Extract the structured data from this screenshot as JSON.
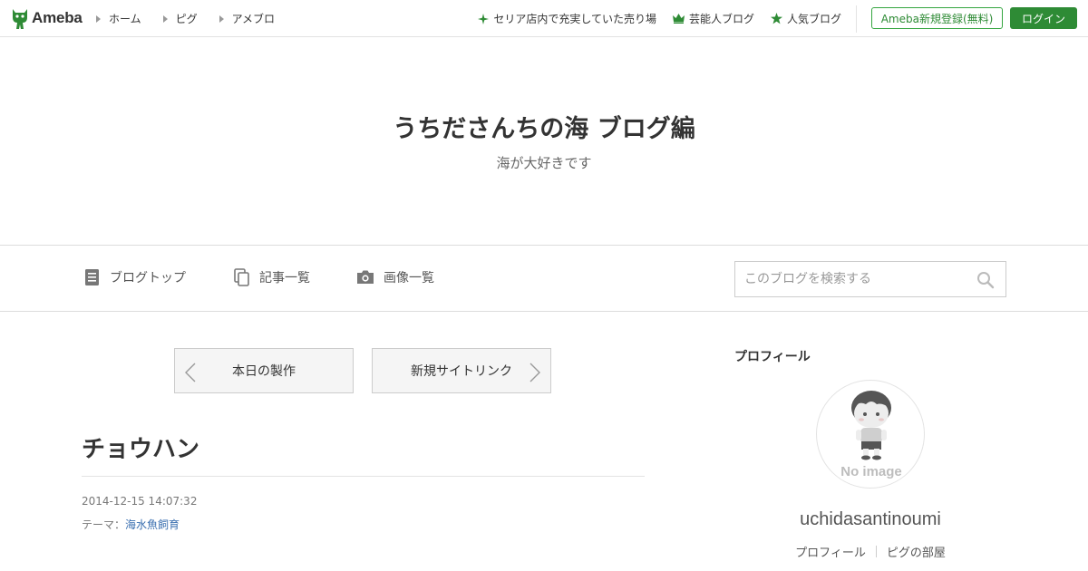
{
  "header": {
    "logo_text": "Ameba",
    "nav": [
      {
        "label": "ホーム"
      },
      {
        "label": "ピグ"
      },
      {
        "label": "アメブロ"
      }
    ],
    "links": [
      {
        "label": "セリア店内で充実していた売り場",
        "icon": "sparkle-icon"
      },
      {
        "label": "芸能人ブログ",
        "icon": "crown-icon"
      },
      {
        "label": "人気ブログ",
        "icon": "star-icon"
      }
    ],
    "register_label": "Ameba新規登録(無料)",
    "login_label": "ログイン",
    "accent_color": "#2e8b35"
  },
  "blog": {
    "title": "うちださんちの海 ブログ編",
    "description": "海が大好きです"
  },
  "blog_nav": {
    "items": [
      {
        "label": "ブログトップ",
        "icon": "document-icon"
      },
      {
        "label": "記事一覧",
        "icon": "copy-icon"
      },
      {
        "label": "画像一覧",
        "icon": "camera-icon"
      }
    ],
    "search_placeholder": "このブログを検索する"
  },
  "main": {
    "prev_label": "本日の製作",
    "next_label": "新規サイトリンク",
    "entry": {
      "title": "チョウハン",
      "date": "2014-12-15 14:07:32",
      "theme_prefix": "テーマ：",
      "theme_link": "海水魚飼育"
    }
  },
  "sidebar": {
    "heading": "プロフィール",
    "avatar_text": "No image",
    "username": "uchidasantinoumi",
    "links": [
      {
        "label": "プロフィール"
      },
      {
        "label": "ピグの部屋"
      }
    ]
  }
}
